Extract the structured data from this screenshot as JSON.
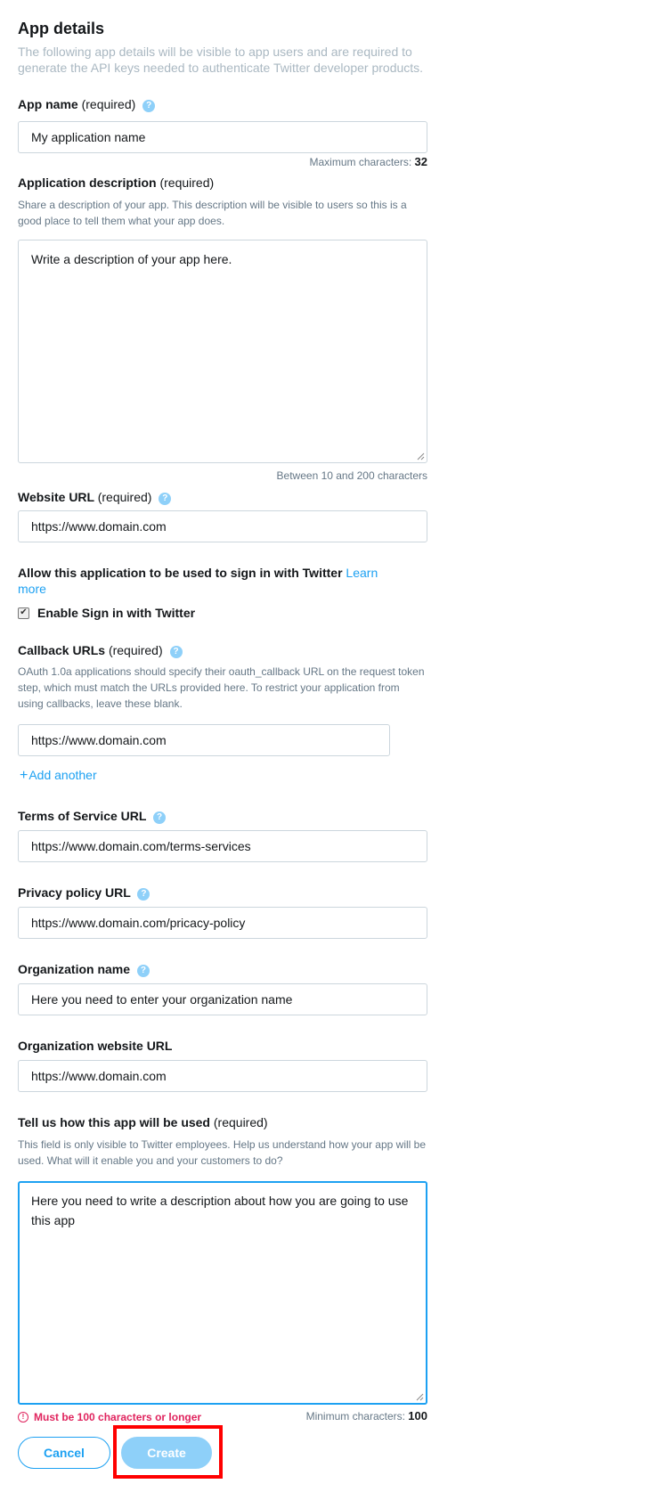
{
  "header": {
    "title": "App details",
    "intro": "The following app details will be visible to app users and are required to generate the API keys needed to authenticate Twitter developer products."
  },
  "help_icon_glyph": "?",
  "app_name": {
    "label": "App name",
    "required": "(required)",
    "value": "My application name",
    "max_label": "Maximum characters:",
    "max_value": "32"
  },
  "app_description": {
    "label": "Application description",
    "required": "(required)",
    "description": "Share a description of your app. This description will be visible to users so this is a good place to tell them what your app does.",
    "value": "Write a description of your app here.",
    "length_hint": "Between 10 and 200 characters"
  },
  "website_url": {
    "label": "Website URL",
    "required": "(required)",
    "value": "https://www.domain.com"
  },
  "sign_in": {
    "label": "Allow this application to be used to sign in with Twitter",
    "learn_more": "Learn more",
    "checkbox_label": "Enable Sign in with Twitter",
    "checked": true,
    "check_glyph": "✔"
  },
  "callback_urls": {
    "label": "Callback URLs",
    "required": "(required)",
    "description": "OAuth 1.0a applications should specify their oauth_callback URL on the request token step, which must match the URLs provided here. To restrict your application from using callbacks, leave these blank.",
    "value": "https://www.domain.com",
    "add_plus": "+",
    "add_another": "Add another"
  },
  "terms_url": {
    "label": "Terms of Service URL",
    "value": "https://www.domain.com/terms-services"
  },
  "privacy_url": {
    "label": "Privacy policy URL",
    "value": "https://www.domain.com/pricacy-policy"
  },
  "org_name": {
    "label": "Organization name",
    "value": "Here you need to enter your organization name"
  },
  "org_website": {
    "label": "Organization website URL",
    "value": "https://www.domain.com"
  },
  "usage": {
    "label": "Tell us how this app will be used",
    "required": "(required)",
    "description": "This field is only visible to Twitter employees. Help us understand how your app will be used. What will it enable you and your customers to do?",
    "value": "Here you need to write a description about how you are going to use this app",
    "error_glyph": "!",
    "error": "Must be 100 characters or longer",
    "min_label": "Minimum characters:",
    "min_value": "100"
  },
  "actions": {
    "cancel": "Cancel",
    "create": "Create"
  },
  "colors": {
    "accent": "#1da1f2",
    "accent_disabled": "#8ed0f9",
    "error": "#e0245e",
    "highlight": "#ff0000"
  },
  "icons": [
    "help-icon",
    "checkbox-check-icon",
    "plus-icon",
    "error-icon",
    "resize-grip-icon"
  ]
}
